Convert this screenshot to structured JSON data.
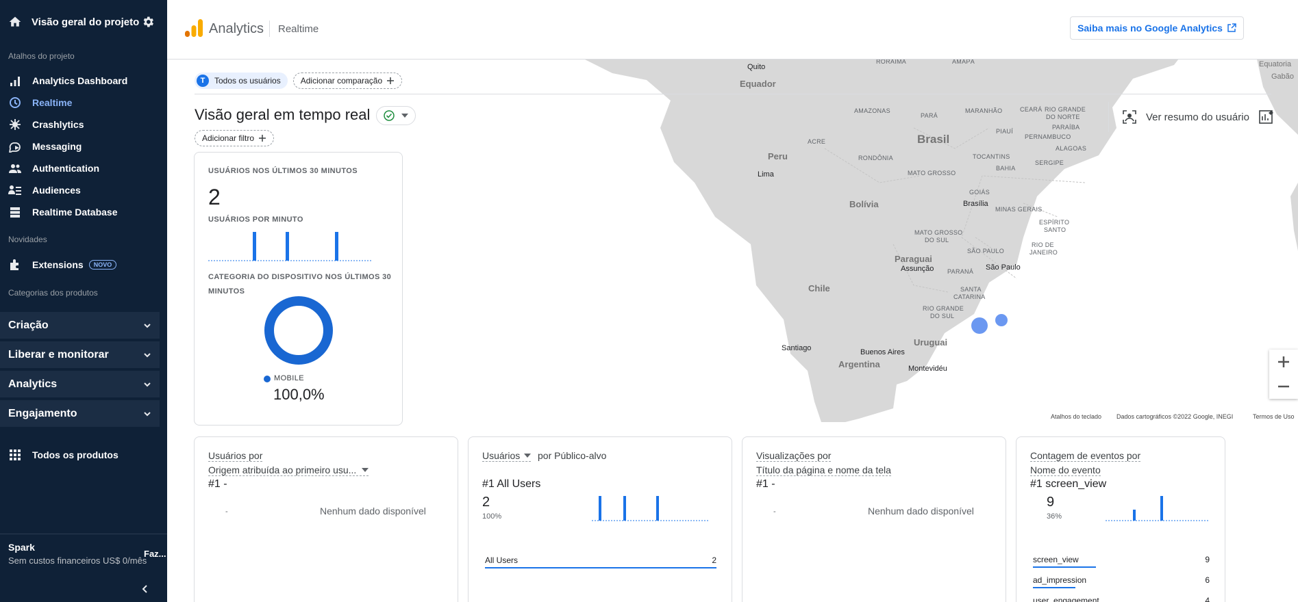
{
  "sidebar": {
    "project_title": "Visão geral do projeto",
    "section_shortcuts": "Atalhos do projeto",
    "items": [
      {
        "label": "Analytics Dashboard",
        "icon": "bar-chart-icon"
      },
      {
        "label": "Realtime",
        "icon": "clock-icon",
        "active": true
      },
      {
        "label": "Crashlytics",
        "icon": "crashlytics-icon"
      },
      {
        "label": "Messaging",
        "icon": "messaging-icon"
      },
      {
        "label": "Authentication",
        "icon": "users-icon"
      },
      {
        "label": "Audiences",
        "icon": "audiences-icon"
      },
      {
        "label": "Realtime Database",
        "icon": "database-icon"
      }
    ],
    "section_news": "Novidades",
    "extensions": {
      "label": "Extensions",
      "badge": "NOVO"
    },
    "section_categories": "Categorias dos produtos",
    "groups": [
      "Criação",
      "Liberar e monitorar",
      "Analytics",
      "Engajamento"
    ],
    "all_products": "Todos os produtos",
    "plan_name": "Spark",
    "plan_desc": "Sem custos financeiros US$ 0/mês",
    "plan_action": "Faz..."
  },
  "header": {
    "app_title": "Analytics",
    "sub_title": "Realtime",
    "learn_more": "Saiba mais no Google Analytics"
  },
  "main": {
    "user_chip": {
      "avatar": "T",
      "label": "Todos os usuários"
    },
    "add_comparison": "Adicionar comparação",
    "title": "Visão geral em tempo real",
    "add_filter": "Adicionar filtro",
    "user_summary": "Ver resumo do usuário"
  },
  "map": {
    "labels_country": [
      "Brasil",
      "Bolívia",
      "Peru",
      "Paraguai",
      "Chile",
      "Argentina",
      "Uruguai",
      "Equador"
    ],
    "labels_region": [
      "AMAZONAS",
      "PARÁ",
      "MARANHÃO",
      "CEARÁ",
      "RIO GRANDE",
      "DO NORTE",
      "PARAÍBA",
      "PIAUÍ",
      "PERNAMBUCO",
      "ALAGOAS",
      "SERGIPE",
      "TOCANTINS",
      "BAHIA",
      "ACRE",
      "RONDÔNIA",
      "MATO GROSSO",
      "GOIÁS",
      "MINAS GERAIS",
      "ESPÍRITO",
      "SANTO",
      "RIO DE",
      "JANEIRO",
      "SÃO PAULO",
      "MATO GROSSO",
      "DO SUL",
      "PARANÁ",
      "SANTA",
      "CATARINA",
      "RIO GRANDE",
      "DO SUL",
      "RORAIMA",
      "AMAPÁ"
    ],
    "labels_city": [
      "Quito",
      "Lima",
      "Brasília",
      "São Paulo",
      "Assunção",
      "Santiago",
      "Buenos Aires",
      "Montevidéu",
      "Equatoria",
      "Gabão"
    ],
    "credits": [
      "Atalhos do teclado",
      "Dados cartográficos ©2022 Google, INEGI",
      "Termos de Uso"
    ],
    "dots": [
      {
        "city": "Paraná"
      },
      {
        "city": "São Paulo"
      }
    ]
  },
  "users_card": {
    "cap_30min": "USUÁRIOS NOS ÚLTIMOS 30 MINUTOS",
    "count": "2",
    "cap_per_minute": "USUÁRIOS POR MINUTO",
    "cap_device": "CATEGORIA DO DISPOSITIVO NOS ÚLTIMOS 30 MINUTOS",
    "device_label": "MOBILE",
    "device_pct": "100,0%",
    "per_minute_values": [
      0,
      0,
      0,
      0,
      0,
      0,
      0,
      0,
      1,
      0,
      0,
      0,
      0,
      0,
      1,
      0,
      0,
      0,
      0,
      0,
      0,
      0,
      0,
      1,
      0,
      0,
      0,
      0,
      0,
      0
    ],
    "accent": "#1a73e8"
  },
  "cards": [
    {
      "t1": "Usuários por",
      "t2": "Origem atribuída ao primeiro usu...",
      "rank": "#1  -",
      "empty": "Nenhum dado disponível",
      "dash": "-"
    },
    {
      "t1": "Usuários",
      "t2": "por Público-alvo",
      "rank": "#1  All Users",
      "big": "2",
      "pct": "100%",
      "list": [
        {
          "label": "All Users",
          "value": "2"
        }
      ]
    },
    {
      "t1": "Visualizações por",
      "t2": "Título da página e nome da tela",
      "rank": "#1  -",
      "empty": "Nenhum dado disponível",
      "dash": "-"
    },
    {
      "t1": "Contagem de eventos por",
      "t2": "Nome do evento",
      "rank": "#1  screen_view",
      "big": "9",
      "pct": "36%",
      "list": [
        {
          "label": "screen_view",
          "value": "9"
        },
        {
          "label": "ad_impression",
          "value": "6"
        },
        {
          "label": "user_engagement",
          "value": "4"
        }
      ]
    }
  ]
}
